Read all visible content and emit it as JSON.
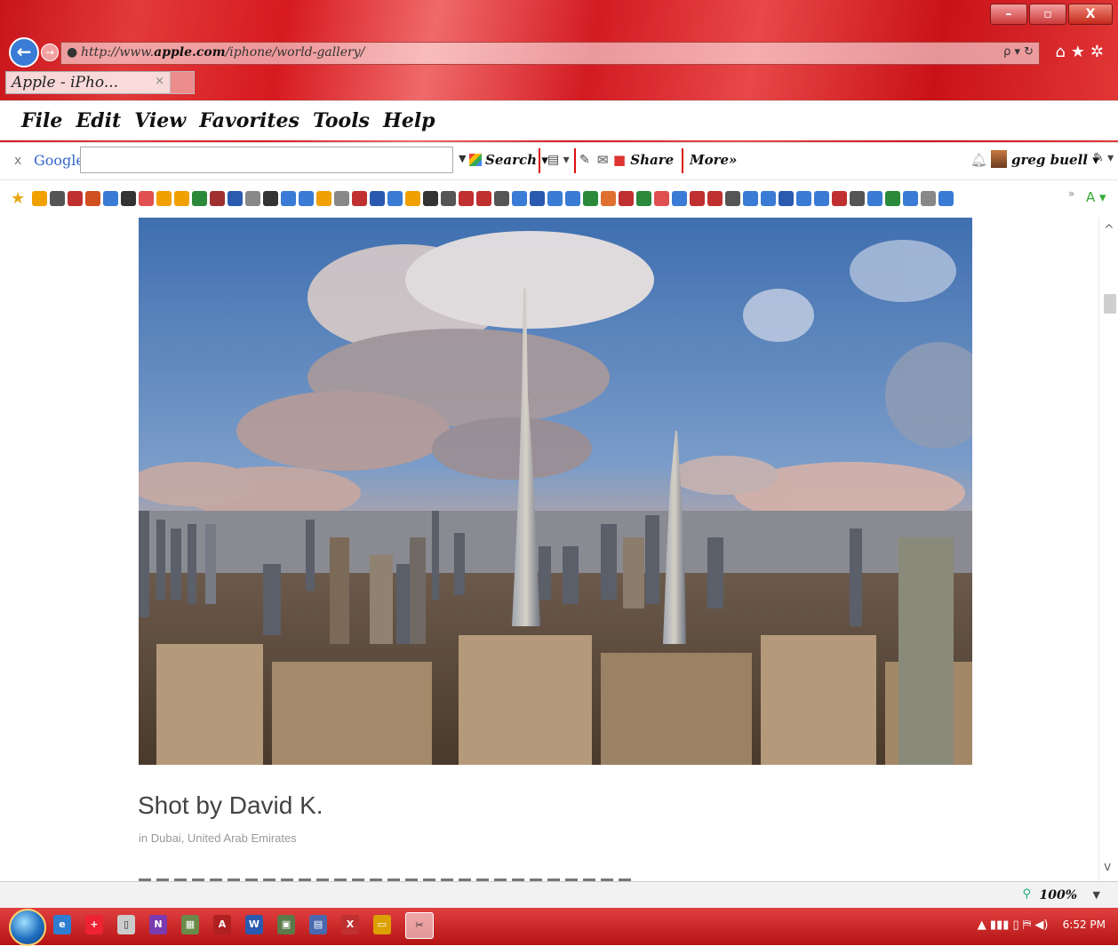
{
  "window": {
    "minimize": "–",
    "maximize": "▫",
    "close": "X"
  },
  "address_bar": {
    "url_prefix": "http://www.",
    "url_domain": "apple.com",
    "url_path": "/iphone/world-gallery/",
    "tools": "ρ ▾ ↻"
  },
  "tab": {
    "title": "Apple - iPho...",
    "close": "×"
  },
  "menu": [
    "File",
    "Edit",
    "View",
    "Favorites",
    "Tools",
    "Help"
  ],
  "google_toolbar": {
    "close": "x",
    "logo": "Google",
    "search_label": "Search",
    "share_label": "Share",
    "more_label": "More»",
    "user_name": "greg buell"
  },
  "content": {
    "caption": "Shot by David K.",
    "location": "in Dubai, United Arab Emirates"
  },
  "status_bar": {
    "zoom": "100%"
  },
  "taskbar": {
    "clock": "6:52 PM"
  },
  "colors": {
    "chrome_red": "#d61a20",
    "taskbar_red": "#c51c1c",
    "back_button_blue": "#3a7bd5",
    "link_blue": "#3366cc"
  }
}
